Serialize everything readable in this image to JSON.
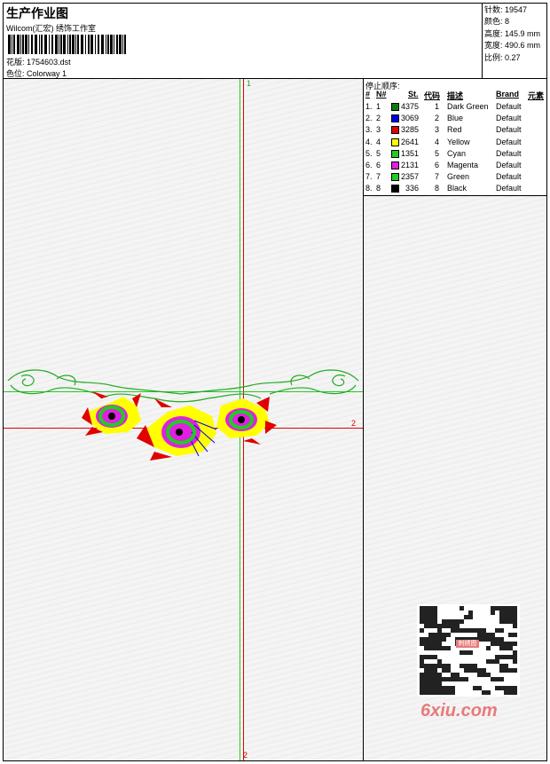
{
  "header": {
    "title": "生产作业图",
    "company": "Wilcom(汇宏) 绣饰工作室",
    "pattern_label": "花版:",
    "pattern_value": "1754603.dst",
    "colorway_label": "色位:",
    "colorway_value": "Colorway 1"
  },
  "stats": {
    "stitches": "针数: 19547",
    "colors": "颜色: 8",
    "height": "高度: 145.9 mm",
    "width": "宽度: 490.6 mm",
    "ratio": "比例: 0.27"
  },
  "legend": {
    "title": "停止顺序:",
    "headers": [
      "#",
      "N#",
      "St.",
      "代码",
      "描述",
      "Brand",
      "元素"
    ],
    "rows": [
      {
        "index": "1.",
        "n": "1",
        "color": "#0a7d0a",
        "st": "4375",
        "code": "1",
        "desc": "Dark Green",
        "brand": "Default"
      },
      {
        "index": "2.",
        "n": "2",
        "color": "#0000e0",
        "st": "3069",
        "code": "2",
        "desc": "Blue",
        "brand": "Default"
      },
      {
        "index": "3.",
        "n": "3",
        "color": "#e00000",
        "st": "3285",
        "code": "3",
        "desc": "Red",
        "brand": "Default"
      },
      {
        "index": "4.",
        "n": "4",
        "color": "#ffff00",
        "st": "2641",
        "code": "4",
        "desc": "Yellow",
        "brand": "Default"
      },
      {
        "index": "5.",
        "n": "5",
        "color": "#22cc22",
        "st": "1351",
        "code": "5",
        "desc": "Cyan",
        "brand": "Default"
      },
      {
        "index": "6.",
        "n": "6",
        "color": "#e020e0",
        "st": "2131",
        "code": "6",
        "desc": "Magenta",
        "brand": "Default"
      },
      {
        "index": "7.",
        "n": "7",
        "color": "#22cc22",
        "st": "2357",
        "code": "7",
        "desc": "Green",
        "brand": "Default"
      },
      {
        "index": "8.",
        "n": "8",
        "color": "#000000",
        "st": "336",
        "code": "8",
        "desc": "Black",
        "brand": "Default"
      }
    ]
  },
  "canvas": {
    "axis_top_label": "1",
    "axis_right_label": "2",
    "axis_bottom_label": "2"
  },
  "watermark": {
    "qr_text": "刺绣图",
    "site": "6xiu.com"
  },
  "colors": {
    "guide_green": "#22cc22",
    "guide_red": "#e00000"
  }
}
